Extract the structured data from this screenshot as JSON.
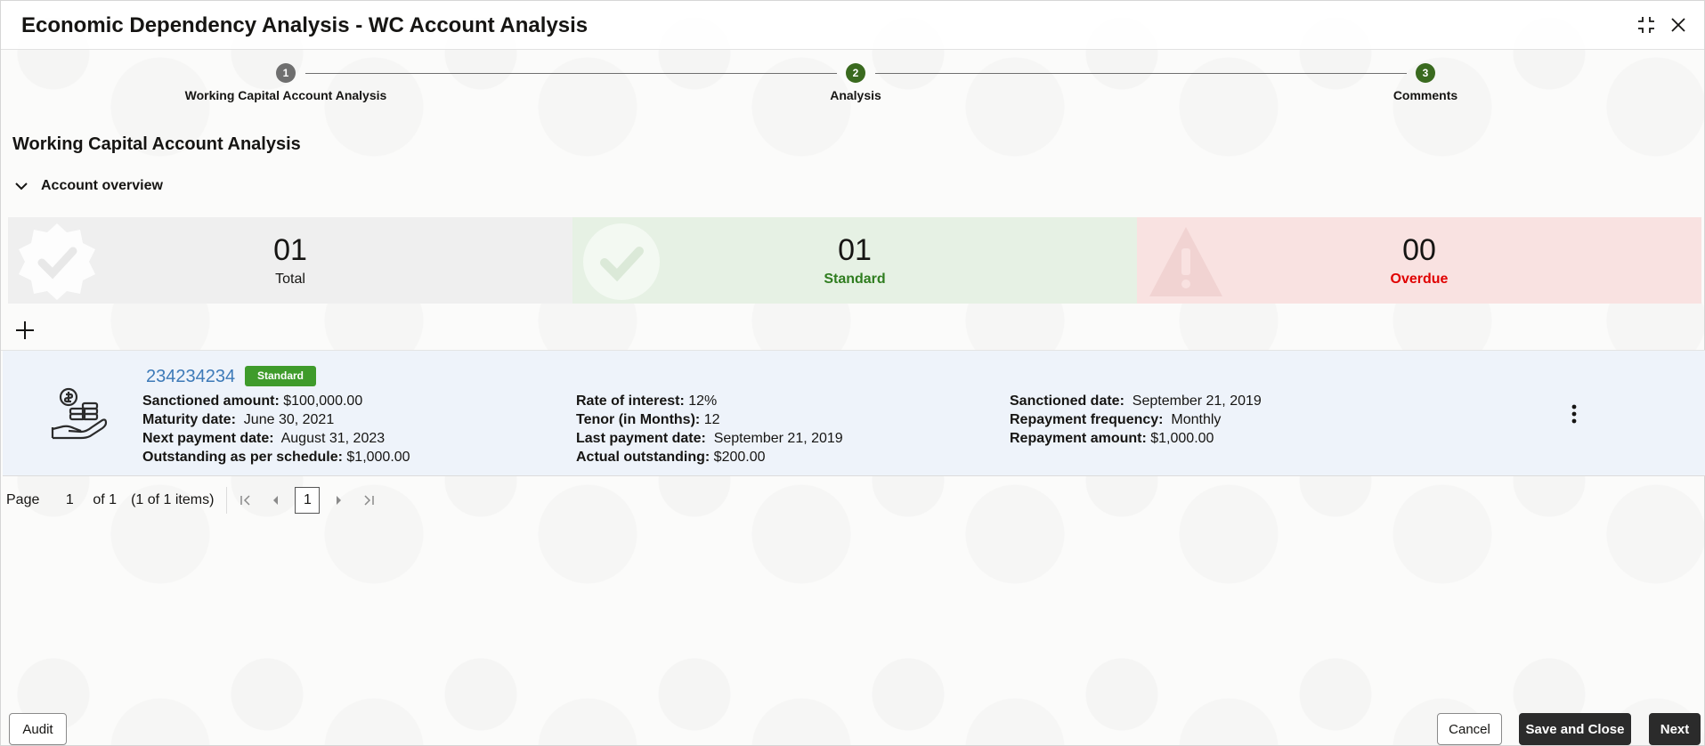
{
  "header": {
    "title": "Economic Dependency Analysis - WC Account Analysis"
  },
  "stepper": {
    "steps": [
      {
        "number": "1",
        "label": "Working Capital Account Analysis",
        "state": "current"
      },
      {
        "number": "2",
        "label": "Analysis",
        "state": "complete"
      },
      {
        "number": "3",
        "label": "Comments",
        "state": "complete"
      }
    ]
  },
  "main": {
    "section_title": "Working Capital Account Analysis",
    "overview_label": "Account overview"
  },
  "summary": {
    "total": {
      "count": "01",
      "label": "Total"
    },
    "standard": {
      "count": "01",
      "label": "Standard"
    },
    "overdue": {
      "count": "00",
      "label": "Overdue"
    }
  },
  "account": {
    "number": "234234234",
    "status": "Standard",
    "col1": [
      {
        "label": "Sanctioned amount:",
        "value": "$100,000.00"
      },
      {
        "label": "Maturity date:",
        "value": "June 30, 2021"
      },
      {
        "label": "Next payment date:",
        "value": "August 31, 2023"
      },
      {
        "label": "Outstanding as per schedule:",
        "value": "$1,000.00"
      }
    ],
    "col2": [
      {
        "label": "Rate of interest:",
        "value": "12%"
      },
      {
        "label": "Tenor (in Months):",
        "value": "12"
      },
      {
        "label": "Last payment date:",
        "value": "September 21, 2019"
      },
      {
        "label": "Actual outstanding:",
        "value": "$200.00"
      }
    ],
    "col3": [
      {
        "label": "Sanctioned date:",
        "value": "September 21, 2019"
      },
      {
        "label": "Repayment frequency:",
        "value": "Monthly"
      },
      {
        "label": "Repayment amount:",
        "value": "$1,000.00"
      }
    ]
  },
  "pagination": {
    "page_label": "Page",
    "page_value": "1",
    "of_label": "of 1",
    "items_label": "(1 of 1 items)",
    "current_page": "1"
  },
  "footer": {
    "audit": "Audit",
    "cancel": "Cancel",
    "save_close": "Save and Close",
    "next": "Next"
  },
  "colors": {
    "step_current": "#6f6f6f",
    "step_complete": "#3a6a1f",
    "standard_badge": "#3f9b2b",
    "overdue_text": "#e00000",
    "account_link": "#3d7ab8"
  }
}
